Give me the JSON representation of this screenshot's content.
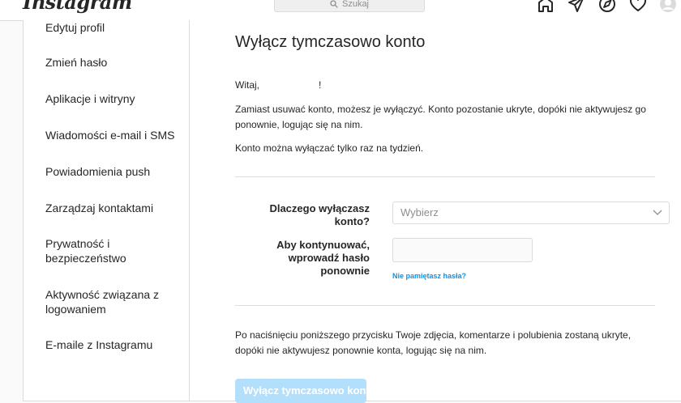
{
  "app": {
    "logo": "Instagram"
  },
  "search": {
    "placeholder": "Szukaj"
  },
  "sidebar": {
    "items": [
      {
        "label": "Edytuj profil"
      },
      {
        "label": "Zmień hasło"
      },
      {
        "label": "Aplikacje i witryny"
      },
      {
        "label": "Wiadomości e-mail i SMS"
      },
      {
        "label": "Powiadomienia push"
      },
      {
        "label": "Zarządzaj kontaktami"
      },
      {
        "label": "Prywatność i bezpieczeństwo"
      },
      {
        "label": "Aktywność związana z logowaniem"
      },
      {
        "label": "E-maile z Instagramu"
      }
    ]
  },
  "main": {
    "title": "Wyłącz tymczasowo konto",
    "greeting_prefix": "Witaj,",
    "greeting_suffix": "!",
    "info1": "Zamiast usuwać konto, możesz je wyłączyć. Konto pozostanie ukryte, dopóki nie aktywujesz go ponownie, logując się na nim.",
    "info2": "Konto można wyłączać tylko raz na tydzień.",
    "reason_label": "Dlaczego wyłączasz konto?",
    "reason_placeholder": "Wybierz",
    "password_label": "Aby kontynuować, wprowadź hasło ponownie",
    "forgot_link": "Nie pamiętasz hasła?",
    "footer_info": "Po naciśnięciu poniższego przycisku Twoje zdjęcia, komentarze i polubienia zostaną ukryte, dopóki nie aktywujesz ponownie konta, logując się na nim.",
    "submit_label": "Wyłącz tymczasowo konto"
  }
}
